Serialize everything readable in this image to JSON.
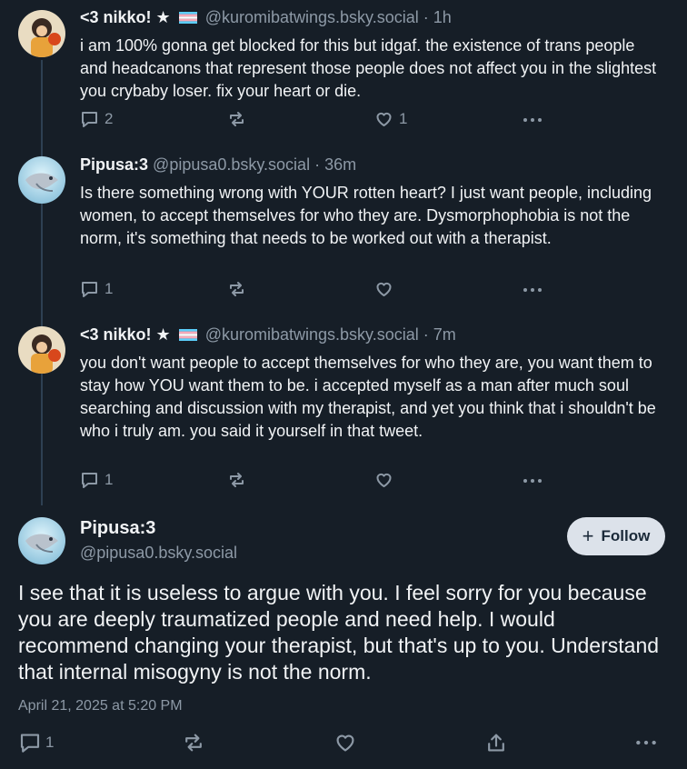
{
  "posts": [
    {
      "display_name": "<3 nikko! ★",
      "handle": "@kuromibatwings.bsky.social",
      "time": "· 1h",
      "text": "i am 100% gonna get blocked for this but idgaf. the existence of trans people and headcanons that represent those people does not affect you in the slightest you crybaby loser. fix your heart or die.",
      "reply_count": "2",
      "repost_count": "",
      "like_count": "1"
    },
    {
      "display_name": "Pipusa:3",
      "handle": "@pipusa0.bsky.social",
      "time": "· 36m",
      "text": "Is there something wrong with YOUR rotten heart? I just want people, including women, to accept themselves for who they are. Dysmorphophobia is not the norm, it's something that needs to be worked out with a therapist.",
      "reply_count": "1",
      "repost_count": "",
      "like_count": ""
    },
    {
      "display_name": "<3 nikko! ★",
      "handle": "@kuromibatwings.bsky.social",
      "time": "· 7m",
      "text": "you don't want people to accept themselves for who they are, you want them to stay how YOU want them to be. i accepted myself as a man after much soul searching and discussion with my therapist, and yet you think that i shouldn't be who i truly am. you said it yourself in that tweet.",
      "reply_count": "1",
      "repost_count": "",
      "like_count": ""
    }
  ],
  "main_post": {
    "display_name": "Pipusa:3",
    "handle": "@pipusa0.bsky.social",
    "follow_label": "Follow",
    "text": "I see that it is useless to argue with you. I feel sorry for you because you are deeply traumatized people and need help. I would recommend changing your therapist, but that's up to you. Understand that internal misogyny is not the norm.",
    "timestamp": "April 21, 2025 at 5:20 PM",
    "reply_count": "1"
  },
  "colors": {
    "background": "#161e27",
    "text": "#f1f3f5",
    "muted": "#8d99a6",
    "thread_line": "#2e4052",
    "follow_bg": "#dce2ea"
  }
}
